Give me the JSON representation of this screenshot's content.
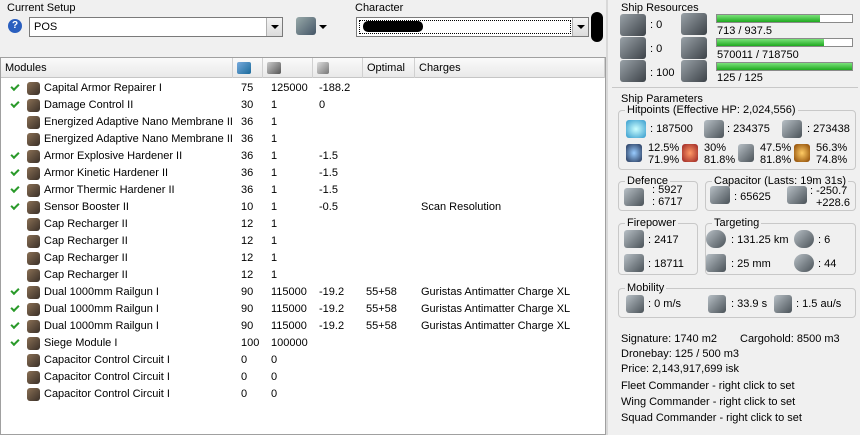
{
  "setup": {
    "title": "Current Setup",
    "value": "POS"
  },
  "character": {
    "title": "Character",
    "value": ""
  },
  "modules": {
    "headers": [
      "Modules",
      "",
      "",
      "",
      "Optimal",
      "Charges"
    ],
    "rows": [
      {
        "checked": true,
        "name": "Capital Armor Repairer I",
        "a": "75",
        "b": "125000",
        "c": "-188.2",
        "optimal": "",
        "charges": ""
      },
      {
        "checked": true,
        "name": "Damage Control II",
        "a": "30",
        "b": "1",
        "c": "0",
        "optimal": "",
        "charges": ""
      },
      {
        "checked": false,
        "name": "Energized Adaptive Nano Membrane II",
        "a": "36",
        "b": "1",
        "c": "",
        "optimal": "",
        "charges": ""
      },
      {
        "checked": false,
        "name": "Energized Adaptive Nano Membrane II",
        "a": "36",
        "b": "1",
        "c": "",
        "optimal": "",
        "charges": ""
      },
      {
        "checked": true,
        "name": "Armor Explosive Hardener II",
        "a": "36",
        "b": "1",
        "c": "-1.5",
        "optimal": "",
        "charges": ""
      },
      {
        "checked": true,
        "name": "Armor Kinetic Hardener II",
        "a": "36",
        "b": "1",
        "c": "-1.5",
        "optimal": "",
        "charges": ""
      },
      {
        "checked": true,
        "name": "Armor Thermic Hardener II",
        "a": "36",
        "b": "1",
        "c": "-1.5",
        "optimal": "",
        "charges": ""
      },
      {
        "checked": true,
        "name": "Sensor Booster II",
        "a": "10",
        "b": "1",
        "c": "-0.5",
        "optimal": "",
        "charges": "Scan Resolution"
      },
      {
        "checked": false,
        "name": "Cap Recharger II",
        "a": "12",
        "b": "1",
        "c": "",
        "optimal": "",
        "charges": ""
      },
      {
        "checked": false,
        "name": "Cap Recharger II",
        "a": "12",
        "b": "1",
        "c": "",
        "optimal": "",
        "charges": ""
      },
      {
        "checked": false,
        "name": "Cap Recharger II",
        "a": "12",
        "b": "1",
        "c": "",
        "optimal": "",
        "charges": ""
      },
      {
        "checked": false,
        "name": "Cap Recharger II",
        "a": "12",
        "b": "1",
        "c": "",
        "optimal": "",
        "charges": ""
      },
      {
        "checked": true,
        "name": "Dual 1000mm Railgun I",
        "a": "90",
        "b": "115000",
        "c": "-19.2",
        "optimal": "55+58",
        "charges": "Guristas Antimatter Charge XL"
      },
      {
        "checked": true,
        "name": "Dual 1000mm Railgun I",
        "a": "90",
        "b": "115000",
        "c": "-19.2",
        "optimal": "55+58",
        "charges": "Guristas Antimatter Charge XL"
      },
      {
        "checked": true,
        "name": "Dual 1000mm Railgun I",
        "a": "90",
        "b": "115000",
        "c": "-19.2",
        "optimal": "55+58",
        "charges": "Guristas Antimatter Charge XL"
      },
      {
        "checked": true,
        "name": "Siege Module I",
        "a": "100",
        "b": "100000",
        "c": "",
        "optimal": "",
        "charges": ""
      },
      {
        "checked": false,
        "name": "Capacitor Control Circuit I",
        "a": "0",
        "b": "0",
        "c": "",
        "optimal": "",
        "charges": ""
      },
      {
        "checked": false,
        "name": "Capacitor Control Circuit I",
        "a": "0",
        "b": "0",
        "c": "",
        "optimal": "",
        "charges": ""
      },
      {
        "checked": false,
        "name": "Capacitor Control Circuit I",
        "a": "0",
        "b": "0",
        "c": "",
        "optimal": "",
        "charges": ""
      }
    ]
  },
  "resources": {
    "title": "Ship Resources",
    "turrets": ": 0",
    "launchers": ": 0",
    "calibration": ": 100",
    "cpu": "713 / 937.5",
    "cpu_fill": 0.76,
    "powergrid": "570011 / 718750",
    "powergrid_fill": 0.79,
    "drone_bw": "125 / 125",
    "drone_fill": 1.0
  },
  "params": {
    "title": "Ship Parameters",
    "hitpoints_title": "Hitpoints (Effective HP: 2,024,556)",
    "shield_hp": ": 187500",
    "armor_hp": ": 234375",
    "hull_hp": ": 273438",
    "res": {
      "em_shield": "12.5%",
      "em_armor": "71.9%",
      "th_shield": "30%",
      "th_armor": "81.8%",
      "ki_shield": "47.5%",
      "ki_armor": "81.8%",
      "ex_shield": "56.3%",
      "ex_armor": "74.8%"
    },
    "defence_title": "Defence",
    "defence_a": ": 5927",
    "defence_b": ": 6717",
    "capacitor_title": "Capacitor (Lasts: 19m 31s)",
    "cap_amount": ": 65625",
    "cap_use": ": -250.7",
    "cap_recharge": "+228.6",
    "firepower_title": "Firepower",
    "fp_a": ": 2417",
    "fp_b": ": 18711",
    "targeting_title": "Targeting",
    "tg_range": ": 131.25 km",
    "tg_targets": ": 6",
    "tg_sig": ": 25 mm",
    "tg_scan": ": 44",
    "mobility_title": "Mobility",
    "speed": ": 0 m/s",
    "align": ": 33.9 s",
    "warp": ": 1.5 au/s",
    "signature": "Signature: 1740 m2",
    "cargohold": "Cargohold: 8500 m3",
    "dronebay": "Dronebay: 125 / 500 m3",
    "price": "Price: 2,143,917,699 isk",
    "fleet": "Fleet Commander - right click to set",
    "wing": "Wing Commander - right click to set",
    "squad": "Squad Commander - right click to set"
  }
}
